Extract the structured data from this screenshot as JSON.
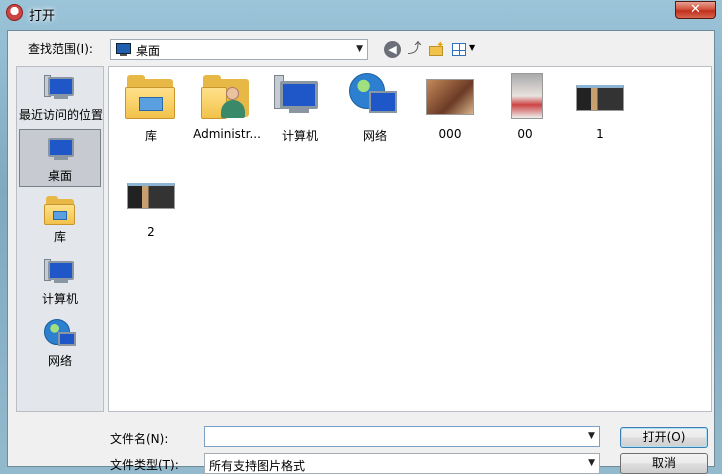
{
  "window": {
    "title": "打开",
    "close_symbol": "✕"
  },
  "toolbar": {
    "lookin_label": "查找范围(I):",
    "lookin_value": "桌面",
    "back_symbol": "◀",
    "up_symbol": "⤴",
    "newfolder_symbol": "✦",
    "view_arrow": "▼",
    "dropdown_arrow": "▼"
  },
  "places": [
    {
      "label": "最近访问的位置",
      "icon": "recent-places-icon"
    },
    {
      "label": "桌面",
      "icon": "desktop-icon",
      "selected": true
    },
    {
      "label": "库",
      "icon": "library-folder-icon"
    },
    {
      "label": "计算机",
      "icon": "computer-icon"
    },
    {
      "label": "网络",
      "icon": "network-icon"
    }
  ],
  "files": [
    {
      "label": "库",
      "icon": "library-folder-icon"
    },
    {
      "label": "Administr...",
      "icon": "user-folder-icon"
    },
    {
      "label": "计算机",
      "icon": "computer-icon"
    },
    {
      "label": "网络",
      "icon": "network-icon"
    },
    {
      "label": "000",
      "icon": "photo-thumbnail"
    },
    {
      "label": "00",
      "icon": "photo-thumbnail"
    },
    {
      "label": "1",
      "icon": "screenshot-thumbnail"
    },
    {
      "label": "2",
      "icon": "screenshot-thumbnail"
    }
  ],
  "footer": {
    "filename_label": "文件名(N):",
    "filename_value": "",
    "filetype_label": "文件类型(T):",
    "filetype_value": "所有支持图片格式",
    "open_label": "打开(O)",
    "cancel_label": "取消"
  },
  "colors": {
    "selection": "#c7cbd1",
    "folder": "#f2c34b",
    "monitor": "#1f56c8",
    "close": "#c0301c"
  }
}
